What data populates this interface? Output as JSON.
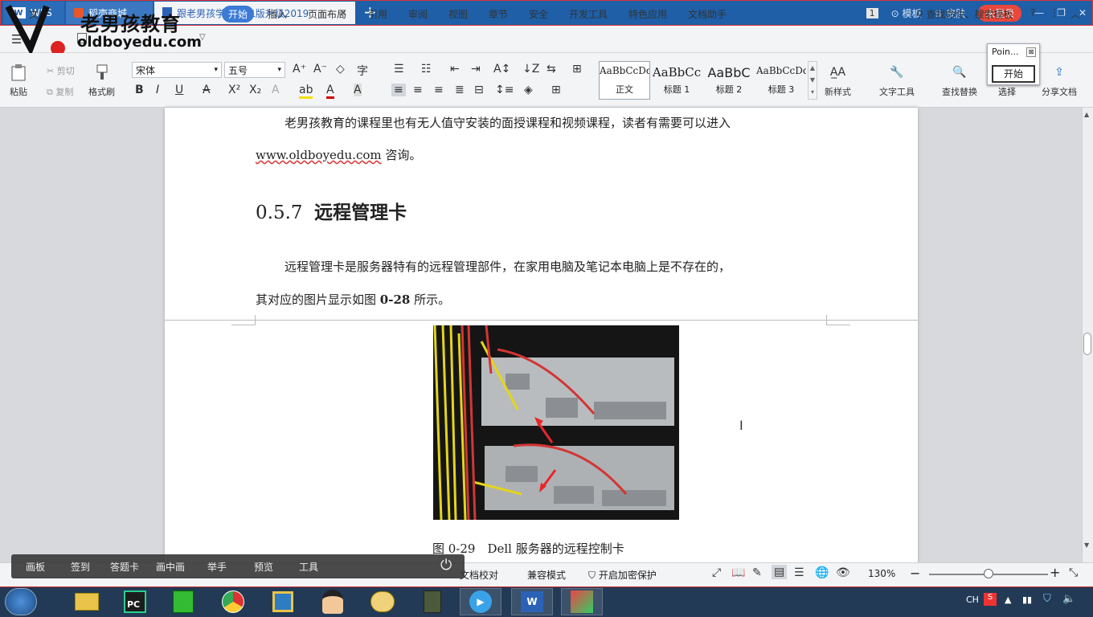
{
  "tabs": [
    {
      "label": "WPS"
    },
    {
      "label": "稻壳商城"
    },
    {
      "label": "跟老男孩学lin...二版升级2019"
    }
  ],
  "title_right": {
    "badge": "1",
    "template": "模板",
    "skin": "皮肤",
    "login": "未登录"
  },
  "watermark": {
    "brand_cn": "老男孩教育",
    "brand_url": "oldboyedu.com"
  },
  "menu": {
    "file": "文",
    "items": [
      "开始",
      "插入",
      "页面布局",
      "引用",
      "审阅",
      "视图",
      "章节",
      "安全",
      "开发工具",
      "特色应用",
      "文档助手"
    ],
    "search": "查找命令、搜索模板"
  },
  "ribbon": {
    "paste": "粘贴",
    "cut": "剪切",
    "copy": "复制",
    "format_painter": "格式刷",
    "font_name": "宋体",
    "font_size": "五号",
    "styles": [
      {
        "preview": "AaBbCcDd",
        "label": "正文"
      },
      {
        "preview": "AaBbCc",
        "label": "标题 1"
      },
      {
        "preview": "AaBbC",
        "label": "标题 2"
      },
      {
        "preview": "AaBbCcDd",
        "label": "标题 3"
      }
    ],
    "new_style": "新样式",
    "text_tools": "文字工具",
    "find_replace": "查找替换",
    "select": "选择",
    "share": "分享文档"
  },
  "popup": {
    "title": "Poin...",
    "button": "开始"
  },
  "document": {
    "p1_line1": "老男孩教育的课程里也有无人值守安装的面授课程和视频课程，读者有需要可以进入",
    "p1_line2_url": "www.oldboyedu.com",
    "p1_line2_rest": " 咨询。",
    "heading_num": "0.5.7",
    "heading_text": "远程管理卡",
    "p2_line1": "远程管理卡是服务器特有的远程管理部件，在家用电脑及笔记本电脑上是不存在的，",
    "p2_line2_a": "其对应的图片显示如图 ",
    "p2_line2_b": "0-28",
    "p2_line2_c": " 所示。",
    "caption": "图 0-29　Dell 服务器的远程控制卡"
  },
  "overlay_bar": {
    "items": [
      "画板",
      "签到",
      "答题卡",
      "画中画",
      "举手",
      "预览",
      "工具"
    ]
  },
  "statusbar": {
    "proofread": "文档校对",
    "compat": "兼容模式",
    "encrypt": "开启加密保护",
    "zoom": "130%"
  },
  "taskbar": {
    "lang": "CH"
  }
}
